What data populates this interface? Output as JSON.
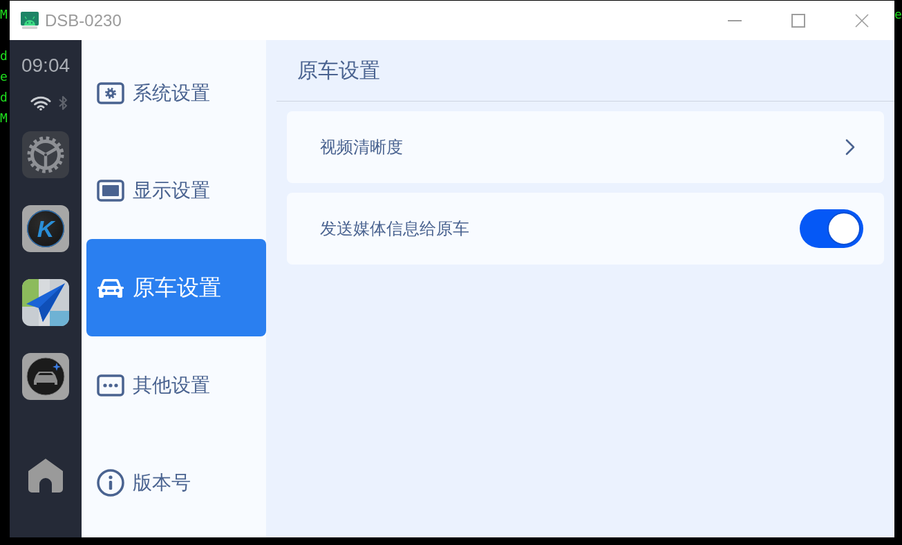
{
  "background_terminal": {
    "left_fragments": [
      "M",
      "d",
      "e",
      "d",
      "M"
    ],
    "right_fragments": [
      "e"
    ]
  },
  "window": {
    "title": "DSB-0230"
  },
  "launcher": {
    "clock": "09:04",
    "logo_letter": "K"
  },
  "nav": {
    "items": [
      {
        "label": "系统设置",
        "selected": false
      },
      {
        "label": "显示设置",
        "selected": false
      },
      {
        "label": "原车设置",
        "selected": true
      },
      {
        "label": "其他设置",
        "selected": false
      },
      {
        "label": "版本号",
        "selected": false
      }
    ]
  },
  "content": {
    "title": "原车设置",
    "rows": [
      {
        "kind": "link",
        "label": "视频清晰度"
      },
      {
        "kind": "toggle",
        "label": "发送媒体信息给原车",
        "on": true
      }
    ]
  }
}
